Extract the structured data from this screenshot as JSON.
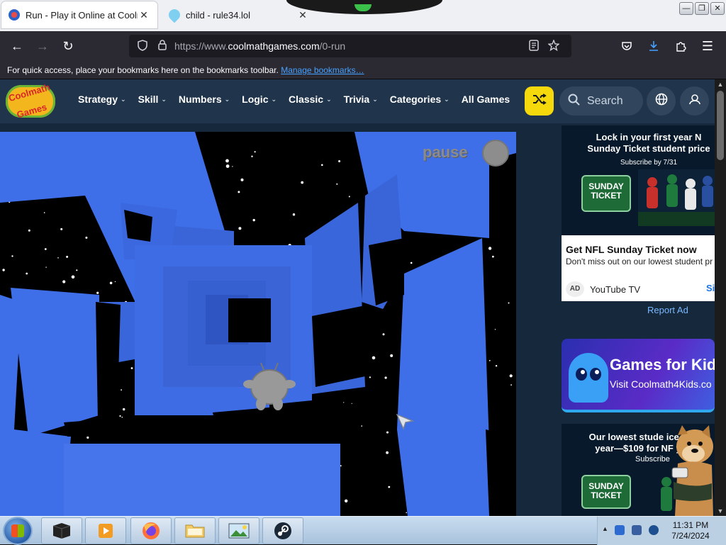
{
  "browser": {
    "tabs": [
      {
        "title": "Run - Play it Online at Coolmath Games",
        "close": "✕"
      },
      {
        "title": "child - rule34.lol",
        "close": "✕"
      }
    ],
    "nav": {
      "back": "←",
      "forward": "→",
      "reload": "↻"
    },
    "url": {
      "prefix": "https://www.",
      "domain": "coolmathgames.com",
      "path": "/0-run"
    },
    "bookmarks_bar": {
      "text": "For quick access, place your bookmarks here on the bookmarks toolbar.",
      "link": "Manage bookmarks…"
    }
  },
  "site": {
    "logo_text": [
      "Coolmath",
      "Games"
    ],
    "menu": [
      {
        "label": "Strategy",
        "chev": "⌄"
      },
      {
        "label": "Skill",
        "chev": "⌄"
      },
      {
        "label": "Numbers",
        "chev": "⌄"
      },
      {
        "label": "Logic",
        "chev": "⌄"
      },
      {
        "label": "Classic",
        "chev": "⌄"
      },
      {
        "label": "Trivia",
        "chev": "⌄"
      },
      {
        "label": "Categories",
        "chev": "⌄"
      },
      {
        "label": "All Games",
        "chev": ""
      }
    ],
    "search_placeholder": "Search",
    "accent": "#f5d90d"
  },
  "game": {
    "pause_label": "pause",
    "colors": {
      "tunnel": "#3f6fe8",
      "space": "#000000"
    }
  },
  "ads": {
    "ad1": {
      "headline": "Lock in your first year N\nSunday Ticket student price",
      "subhead": "Subscribe by 7/31",
      "ticket": [
        "SUNDAY",
        "TICKET"
      ],
      "title": "Get NFL Sunday Ticket now",
      "body": "Don't miss out on our lowest student pr",
      "ad_badge": "AD",
      "advertiser": "YouTube TV",
      "cta": "Si"
    },
    "report": "Report Ad",
    "ad2": {
      "headline": "Games for Kid",
      "sub": "Visit Coolmath4Kids.co"
    },
    "ad3": {
      "headline": "Our lowest stude   ice o\nyear—$109 for NF      y",
      "sub": "Subscribe",
      "ticket": [
        "SUNDAY",
        "TICKET"
      ]
    }
  },
  "taskbar": {
    "time": "11:31 PM",
    "date": "7/24/2024"
  }
}
